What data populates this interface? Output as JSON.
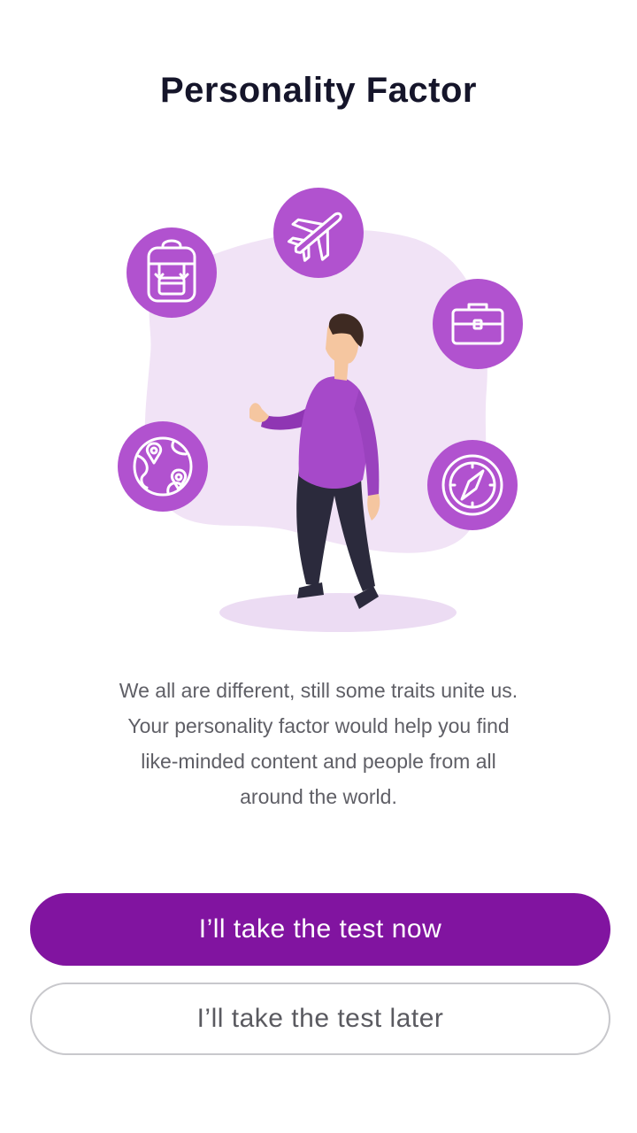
{
  "header": {
    "title": "Personality Factor"
  },
  "illustration": {
    "icons": [
      "backpack-icon",
      "airplane-icon",
      "briefcase-icon",
      "globe-pin-icon",
      "compass-icon"
    ],
    "colors": {
      "circle": "#b152cf",
      "blob": "#f1e3f6",
      "shadow": "#ecdcf3",
      "sweater": "#a649c9",
      "pants": "#2b2a3c",
      "skin": "#f5c6a0",
      "hair": "#3e2a22"
    }
  },
  "body": {
    "description_lines": [
      "We all are different, still some traits unite us.",
      "Your personality factor would help you find",
      "like-minded content and people from all",
      "around the world."
    ]
  },
  "actions": {
    "primary_label": "I’ll take the test now",
    "secondary_label": "I’ll take the test later"
  },
  "colors": {
    "primary_button": "#8114a0",
    "title_text": "#15152a",
    "body_text": "#5f5f66",
    "secondary_border": "#c8c8cc"
  }
}
